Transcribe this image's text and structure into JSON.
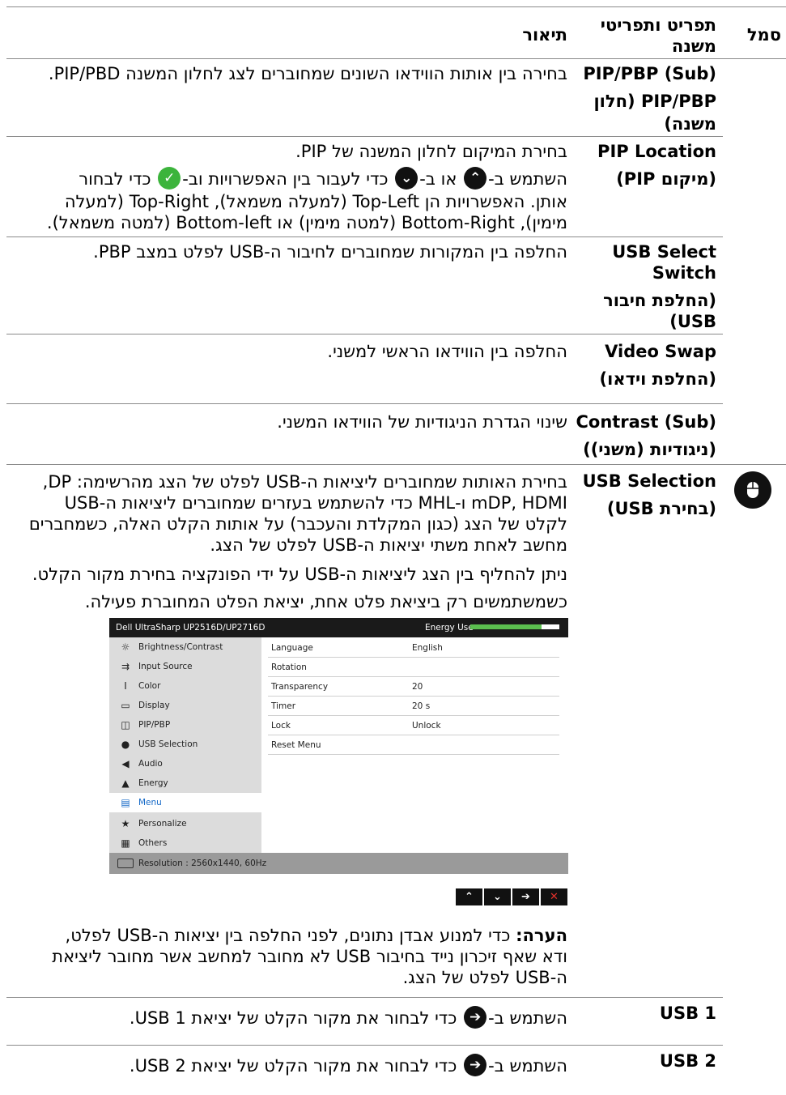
{
  "header": {
    "symbol": "סמל",
    "item": [
      "תפריט ותפריטי",
      "משנה"
    ],
    "description": "תיאור"
  },
  "rows": {
    "pip_pbp_sub": {
      "item": [
        "PIP/PBP (Sub)",
        "PIP/PBP (חלון",
        "משנה)"
      ],
      "desc": [
        "בחירה בין אותות הווידאו השונים שמחוברים לצג לחלון המשנה PIP/PBD."
      ]
    },
    "pip_location": {
      "item": [
        "PIP Location",
        "(מיקום PIP)"
      ],
      "desc": [
        "בחירת המיקום לחלון המשנה של PIP.",
        "השתמש ב-",
        "או ב-",
        "כדי לעבור בין האפשרויות וב-",
        "כדי לבחור",
        "אותן. האפשרויות הן Top-Left (למעלה משמאל), Top-Right (למעלה",
        "מימין), Bottom-Right (למטה מימין) או Bottom-left (למטה משמאל)."
      ]
    },
    "usb_select_switch": {
      "item": [
        "USB Select",
        "Switch",
        "(החלפת חיבור",
        "USB)"
      ],
      "desc": [
        "החלפה בין המקורות שמחוברים לחיבור ה-USB לפלט במצב PBP."
      ]
    },
    "video_swap": {
      "item": [
        "Video Swap",
        "(החלפת וידאו)"
      ],
      "desc": [
        "החלפה בין הווידאו הראשי למשני."
      ]
    },
    "contrast_sub": {
      "item": [
        "Contrast (Sub)",
        "(ניגודיות (משני))"
      ],
      "desc": [
        "שינוי הגדרת הניגודיות של הווידאו המשני."
      ]
    },
    "usb_selection": {
      "icon": "mouse-icon",
      "item": [
        "USB Selection",
        "(בחירת USB)"
      ],
      "desc": [
        "בחירת האותות שמחוברים ליציאות ה-USB לפלט של הצג מהרשימה: DP,",
        "mDP, HDMI ו-MHL כדי להשתמש בעזרים שמחוברים ליציאות ה-USB",
        "לקלט של הצג (כגון המקלדת והעכבר) על אותות הקלט האלה, כשמחברים",
        "מחשב לאחת משתי יציאות ה-USB לפלט של הצג.",
        "ניתן להחליף בין הצג ליציאות ה-USB על ידי הפונקציה בחירת מקור הקלט.",
        "כשמשתמשים רק ביציאת פלט אחת, יציאת הפלט המחוברת פעילה."
      ]
    }
  },
  "osd": {
    "title": "Dell UltraSharp UP2516D/UP2716D",
    "energy_label": "Energy Use",
    "energy_level": 0.8,
    "menu": [
      {
        "icon": "brightness-icon",
        "label": "Brightness/Contrast"
      },
      {
        "icon": "input-source-icon",
        "label": "Input Source"
      },
      {
        "icon": "color-icon",
        "label": "Color"
      },
      {
        "icon": "display-icon",
        "label": "Display"
      },
      {
        "icon": "pip-icon",
        "label": "PIP/PBP"
      },
      {
        "icon": "mouse-icon",
        "label": "USB Selection"
      },
      {
        "icon": "audio-icon",
        "label": "Audio"
      },
      {
        "icon": "energy-icon",
        "label": "Energy"
      },
      {
        "icon": "menu-icon",
        "label": "Menu"
      },
      {
        "icon": "star-icon",
        "label": "Personalize"
      },
      {
        "icon": "others-icon",
        "label": "Others"
      }
    ],
    "settings": [
      {
        "key": "Language",
        "value": "English"
      },
      {
        "key": "Rotation",
        "value": ""
      },
      {
        "key": "Transparency",
        "value": "20"
      },
      {
        "key": "Timer",
        "value": "20 s"
      },
      {
        "key": "Lock",
        "value": "Unlock"
      },
      {
        "key": "Reset Menu",
        "value": ""
      }
    ],
    "resolution": "Resolution : 2560x1440, 60Hz"
  },
  "note": {
    "label": "הערה:",
    "lines": [
      "כדי למנוע אבדן נתונים, לפני החלפה בין יציאות ה-USB לפלט,",
      "ודא שאף זיכרון נייד בחיבור USB לא מחובר למחשב אשר מחובר ליציאת",
      "ה-USB לפלט של הצג."
    ]
  },
  "usb1": {
    "item": "USB 1",
    "pre": "השתמש ב-",
    "post": "כדי לבחור את מקור הקלט של יציאת USB 1."
  },
  "usb2": {
    "item": "USB 2",
    "pre": "השתמש ב-",
    "post": "כדי לבחור את מקור הקלט של יציאת USB 2."
  }
}
